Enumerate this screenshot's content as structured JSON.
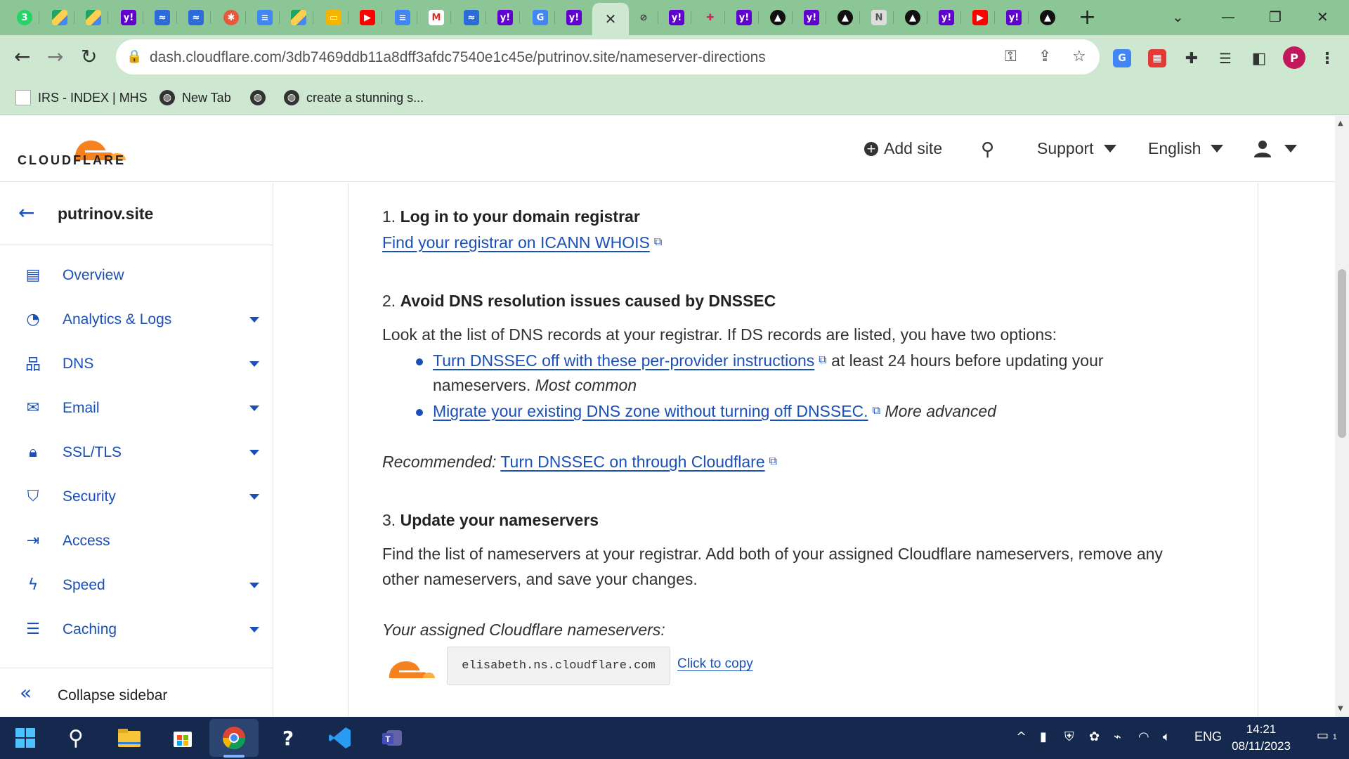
{
  "browser": {
    "address": "dash.cloudflare.com/3db7469ddb11a8dff3afdc7540e1c45e/putrinov.site/nameserver-directions",
    "bookmarks": [
      "IRS - INDEX | MHS",
      "New Tab",
      "",
      "create a stunning s..."
    ],
    "profile_initial": "P"
  },
  "header": {
    "logo_text": "CLOUDFLARE",
    "add_site": "Add site",
    "support": "Support",
    "language": "English"
  },
  "sidebar": {
    "domain": "putrinov.site",
    "items": [
      {
        "label": "Overview"
      },
      {
        "label": "Analytics & Logs"
      },
      {
        "label": "DNS"
      },
      {
        "label": "Email"
      },
      {
        "label": "SSL/TLS"
      },
      {
        "label": "Security"
      },
      {
        "label": "Access"
      },
      {
        "label": "Speed"
      },
      {
        "label": "Caching"
      }
    ],
    "collapse": "Collapse sidebar"
  },
  "content": {
    "step1_num": "1.",
    "step1_title": "Log in to your domain registrar",
    "step1_link": "Find your registrar on ICANN WHOIS",
    "step2_num": "2.",
    "step2_title": "Avoid DNS resolution issues caused by DNSSEC",
    "step2_text": "Look at the list of DNS records at your registrar. If DS records are listed, you have two options:",
    "bullet1_link": "Turn DNSSEC off with these per-provider instructions",
    "bullet1_text": "at least 24 hours before updating your",
    "bullet1_text2": "nameservers.",
    "bullet1_em": "Most common",
    "bullet2_link": "Migrate your existing DNS zone without turning off DNSSEC.",
    "bullet2_em": "More advanced",
    "recommended_label": "Recommended:",
    "recommended_link": "Turn DNSSEC on through Cloudflare",
    "step3_num": "3.",
    "step3_title": "Update your nameservers",
    "step3_text1": "Find the list of nameservers at your registrar. Add both of your assigned Cloudflare nameservers, remove any",
    "step3_text2": "other nameservers, and save your changes.",
    "assigned_label": "Your assigned Cloudflare nameservers:",
    "nameserver1": "elisabeth.ns.cloudflare.com",
    "copy_label": "Click to copy"
  },
  "taskbar": {
    "lang": "ENG",
    "time": "14:21",
    "date": "08/11/2023",
    "notif_count": "1"
  },
  "colors": {
    "link": "#1a4fb8",
    "cf_orange": "#f6821f",
    "tab_bg": "#8cc596",
    "toolbar_bg": "#cde7d1",
    "taskbar_bg": "#14294d"
  }
}
